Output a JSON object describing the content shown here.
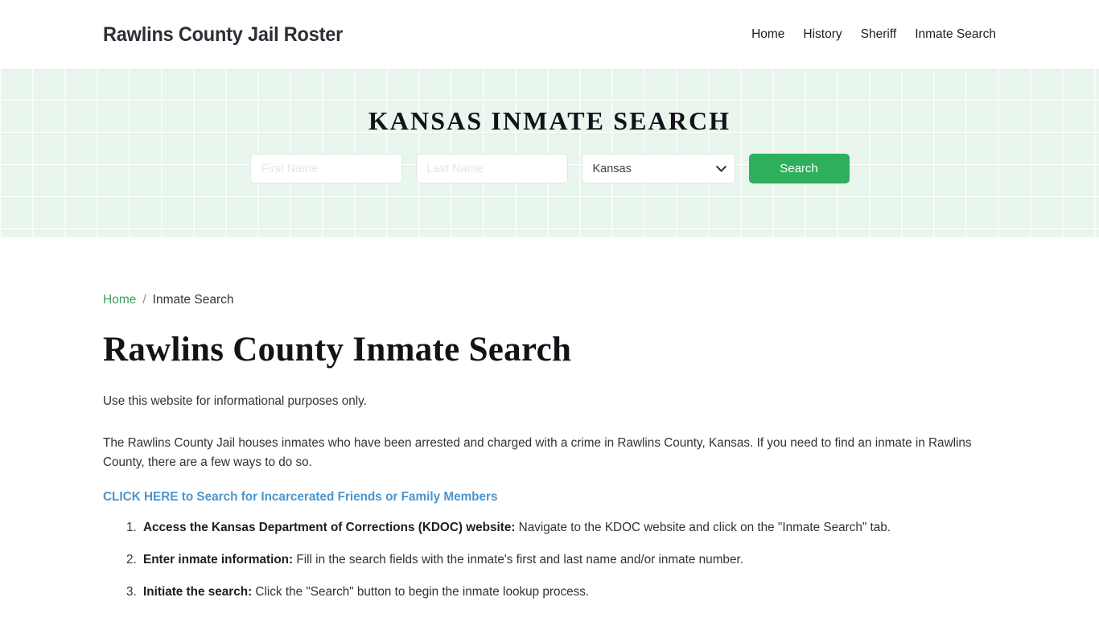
{
  "header": {
    "brand": "Rawlins County Jail Roster",
    "nav": [
      {
        "label": "Home"
      },
      {
        "label": "History"
      },
      {
        "label": "Sheriff"
      },
      {
        "label": "Inmate Search"
      }
    ]
  },
  "hero": {
    "title": "KANSAS INMATE SEARCH",
    "form": {
      "first_name_placeholder": "First Name",
      "first_name_value": "",
      "last_name_placeholder": "Last Name",
      "last_name_value": "",
      "state_selected": "Kansas",
      "state_options": [
        "Kansas"
      ],
      "chevron_icon": "chevron-down-icon",
      "search_button": "Search"
    },
    "accent_color": "#2eaf5c",
    "background_color": "#e9f6ee"
  },
  "breadcrumb": {
    "home": "Home",
    "separator": "/",
    "current": "Inmate Search"
  },
  "main": {
    "page_title": "Rawlins County Inmate Search",
    "paragraph_1": "Use this website for informational purposes only.",
    "paragraph_2": "The Rawlins County Jail houses inmates who have been arrested and charged with a crime in Rawlins County, Kansas. If you need to find an inmate in Rawlins County, there are a few ways to do so.",
    "cta_link": "CLICK HERE to Search for Incarcerated Friends or Family Members",
    "cta_color": "#4a95cf",
    "steps": [
      {
        "lead": "Access the Kansas Department of Corrections (KDOC) website:",
        "rest": " Navigate to the KDOC website and click on the \"Inmate Search\" tab."
      },
      {
        "lead": "Enter inmate information:",
        "rest": " Fill in the search fields with the inmate's first and last name and/or inmate number."
      },
      {
        "lead": "Initiate the search:",
        "rest": " Click the \"Search\" button to begin the inmate lookup process."
      }
    ]
  }
}
